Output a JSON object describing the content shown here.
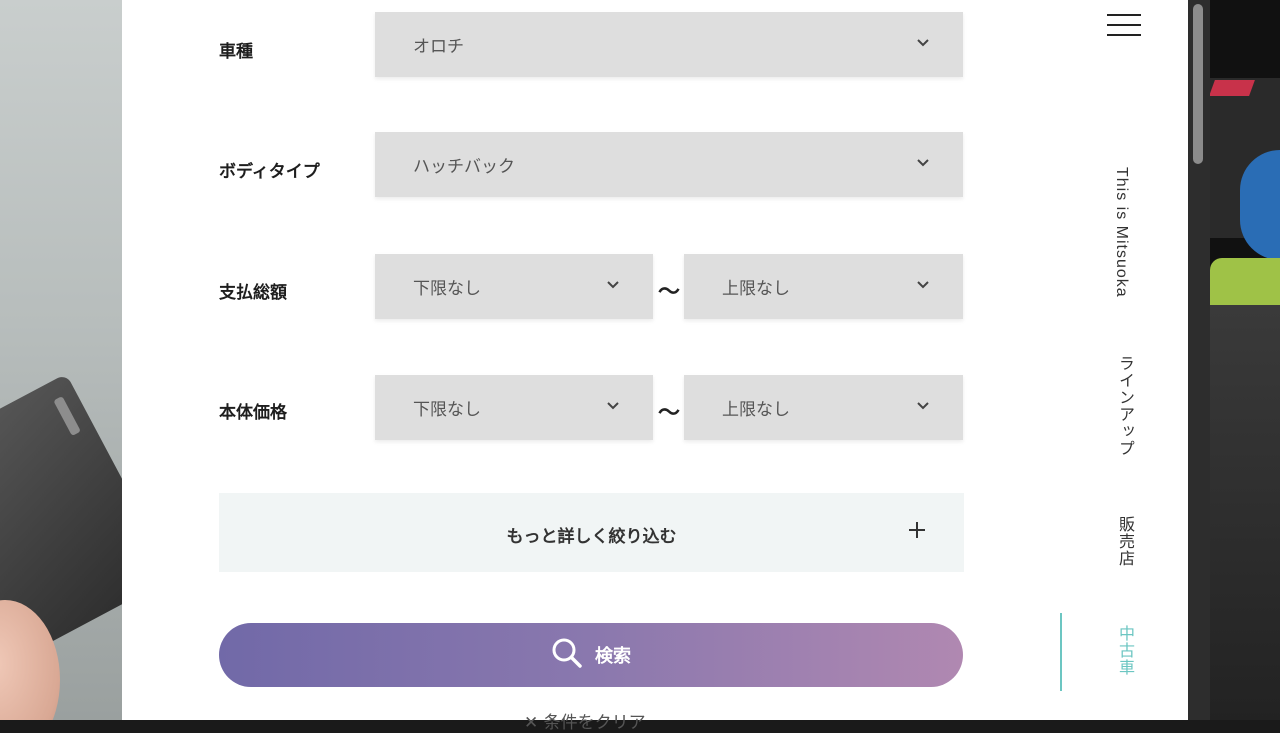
{
  "form": {
    "car_model": {
      "label": "車種",
      "value": "オロチ"
    },
    "body_type": {
      "label": "ボディタイプ",
      "value": "ハッチバック"
    },
    "total_payment": {
      "label": "支払総額",
      "min": "下限なし",
      "max": "上限なし",
      "separator": "〜"
    },
    "body_price": {
      "label": "本体価格",
      "min": "下限なし",
      "max": "上限なし",
      "separator": "〜"
    },
    "more_filters_label": "もっと詳しく絞り込む",
    "search_label": "検索",
    "clear_label": "✕ 条件をクリア"
  },
  "nav": {
    "items": [
      {
        "label": "This is Mitsuoka",
        "active": false
      },
      {
        "label": "ラインアップ",
        "active": false
      },
      {
        "label": "販売店",
        "active": false
      },
      {
        "label": "中古車",
        "active": true
      }
    ]
  },
  "colors": {
    "accent": "#6cc6c2",
    "select_bg": "#dedede",
    "search_gradient_start": "#7169a8",
    "search_gradient_end": "#b088b1"
  },
  "icons": {
    "menu": "hamburger-icon",
    "dropdown": "chevron-down-icon",
    "expand": "plus-icon",
    "search": "search-icon"
  }
}
